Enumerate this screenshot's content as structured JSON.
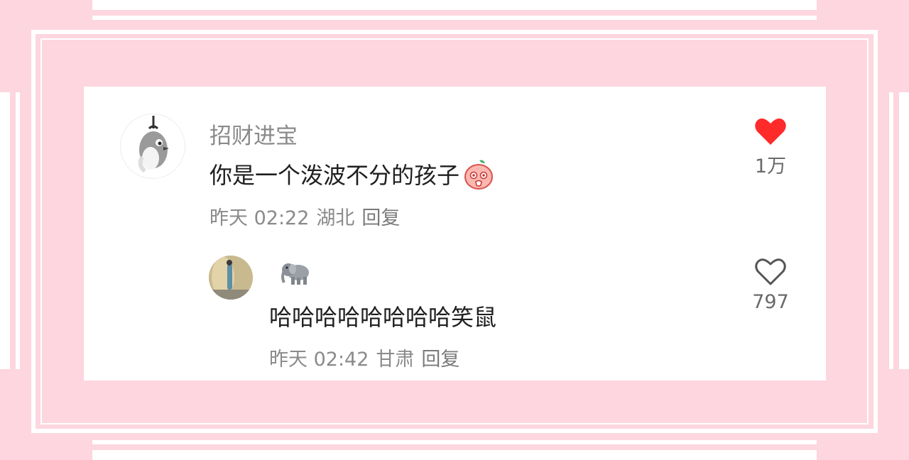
{
  "comments": [
    {
      "username": "招财进宝",
      "text": "你是一个泼波不分的孩子",
      "text_emoji": "peach-face-emoji",
      "time": "昨天 02:22",
      "location": "湖北",
      "reply_label": "回复",
      "likes": "1万",
      "liked": true,
      "avatar_icon": "cartoon-bird-avatar"
    },
    {
      "username_emoji": "elephant-emoji",
      "text": "哈哈哈哈哈哈哈哈笑鼠",
      "time": "昨天 02:42",
      "location": "甘肃",
      "reply_label": "回复",
      "likes": "797",
      "liked": false,
      "avatar_icon": "photo-avatar"
    }
  ],
  "colors": {
    "background": "#fdd6df",
    "liked_heart": "#ff2a2a",
    "muted_text": "#8a8a8a",
    "body_text": "#1f1f1f"
  }
}
